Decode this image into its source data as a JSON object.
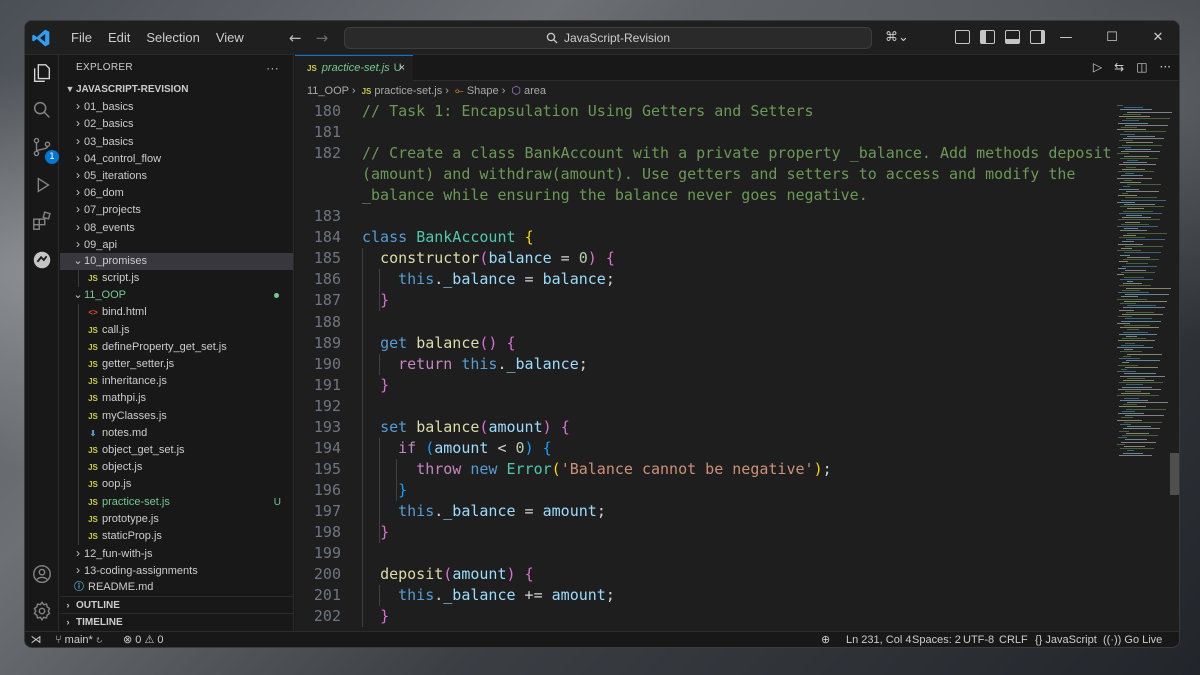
{
  "menu": [
    "File",
    "Edit",
    "Selection",
    "View"
  ],
  "search": {
    "label": "JavaScript-Revision"
  },
  "window_controls": {
    "minimize": "—",
    "maximize": "☐",
    "close": "✕"
  },
  "activity": {
    "source_control_badge": "1"
  },
  "explorer": {
    "title": "EXPLORER",
    "more": "···",
    "root": "JAVASCRIPT-REVISION",
    "items": [
      {
        "type": "folder",
        "name": "01_basics",
        "open": false,
        "level": 1
      },
      {
        "type": "folder",
        "name": "02_basics",
        "open": false,
        "level": 1
      },
      {
        "type": "folder",
        "name": "03_basics",
        "open": false,
        "level": 1
      },
      {
        "type": "folder",
        "name": "04_control_flow",
        "open": false,
        "level": 1
      },
      {
        "type": "folder",
        "name": "05_iterations",
        "open": false,
        "level": 1
      },
      {
        "type": "folder",
        "name": "06_dom",
        "open": false,
        "level": 1
      },
      {
        "type": "folder",
        "name": "07_projects",
        "open": false,
        "level": 1
      },
      {
        "type": "folder",
        "name": "08_events",
        "open": false,
        "level": 1
      },
      {
        "type": "folder",
        "name": "09_api",
        "open": false,
        "level": 1
      },
      {
        "type": "folder",
        "name": "10_promises",
        "open": true,
        "level": 1,
        "selected": true
      },
      {
        "type": "js",
        "name": "script.js",
        "level": 2
      },
      {
        "type": "folder",
        "name": "11_OOP",
        "open": true,
        "level": 1,
        "modified": true
      },
      {
        "type": "html",
        "name": "bind.html",
        "level": 2
      },
      {
        "type": "js",
        "name": "call.js",
        "level": 2
      },
      {
        "type": "js",
        "name": "defineProperty_get_set.js",
        "level": 2
      },
      {
        "type": "js",
        "name": "getter_setter.js",
        "level": 2
      },
      {
        "type": "js",
        "name": "inheritance.js",
        "level": 2
      },
      {
        "type": "js",
        "name": "mathpi.js",
        "level": 2
      },
      {
        "type": "js",
        "name": "myClasses.js",
        "level": 2
      },
      {
        "type": "md",
        "name": "notes.md",
        "level": 2
      },
      {
        "type": "js",
        "name": "object_get_set.js",
        "level": 2
      },
      {
        "type": "js",
        "name": "object.js",
        "level": 2
      },
      {
        "type": "js",
        "name": "oop.js",
        "level": 2
      },
      {
        "type": "js",
        "name": "practice-set.js",
        "level": 2,
        "status": "U"
      },
      {
        "type": "js",
        "name": "prototype.js",
        "level": 2
      },
      {
        "type": "js",
        "name": "staticProp.js",
        "level": 2
      },
      {
        "type": "folder",
        "name": "12_fun-with-js",
        "open": false,
        "level": 1
      },
      {
        "type": "folder",
        "name": "13-coding-assignments",
        "open": false,
        "level": 1
      },
      {
        "type": "info",
        "name": "README.md",
        "level": 1
      }
    ],
    "outline": "OUTLINE",
    "timeline": "TIMELINE"
  },
  "tab": {
    "icon": "JS",
    "name": "practice-set.js",
    "status": "U",
    "close": "×"
  },
  "breadcrumb": {
    "folder": "11_OOP",
    "icon": "JS",
    "file": "practice-set.js",
    "symbol1": "Shape",
    "symbol2": "area"
  },
  "code_lines": [
    {
      "n": "180",
      "tokens": [
        [
          "c-com",
          "// Task 1: Encapsulation Using Getters and Setters"
        ]
      ]
    },
    {
      "n": "181",
      "tokens": []
    },
    {
      "n": "182",
      "tokens": [
        [
          "c-com",
          "// Create a class BankAccount with a private property _balance. Add methods deposit"
        ]
      ]
    },
    {
      "n": "",
      "tokens": [
        [
          "c-com",
          "(amount) and withdraw(amount). Use getters and setters to access and modify the"
        ]
      ]
    },
    {
      "n": "",
      "tokens": [
        [
          "c-com",
          "_balance while ensuring the balance never goes negative."
        ]
      ]
    },
    {
      "n": "183",
      "tokens": []
    },
    {
      "n": "184",
      "tokens": [
        [
          "c-kw",
          "class "
        ],
        [
          "c-cls",
          "BankAccount "
        ],
        [
          "c-b1",
          "{"
        ]
      ]
    },
    {
      "n": "185",
      "tokens": [
        [
          "",
          "  "
        ],
        [
          "c-fn",
          "constructor"
        ],
        [
          "c-b2",
          "("
        ],
        [
          "c-var",
          "balance"
        ],
        [
          "",
          " = "
        ],
        [
          "c-num",
          "0"
        ],
        [
          "c-b2",
          ")"
        ],
        [
          "",
          " "
        ],
        [
          "c-b2",
          "{"
        ]
      ]
    },
    {
      "n": "186",
      "tokens": [
        [
          "",
          "    "
        ],
        [
          "c-kw",
          "this"
        ],
        [
          "",
          "."
        ],
        [
          "c-var",
          "_balance"
        ],
        [
          "",
          " = "
        ],
        [
          "c-var",
          "balance"
        ],
        [
          "",
          ";"
        ]
      ]
    },
    {
      "n": "187",
      "tokens": [
        [
          "",
          "  "
        ],
        [
          "c-b2",
          "}"
        ]
      ]
    },
    {
      "n": "188",
      "tokens": []
    },
    {
      "n": "189",
      "tokens": [
        [
          "",
          "  "
        ],
        [
          "c-kw",
          "get "
        ],
        [
          "c-fn",
          "balance"
        ],
        [
          "c-b2",
          "()"
        ],
        [
          "",
          " "
        ],
        [
          "c-b2",
          "{"
        ]
      ]
    },
    {
      "n": "190",
      "tokens": [
        [
          "",
          "    "
        ],
        [
          "c-kw2",
          "return "
        ],
        [
          "c-kw",
          "this"
        ],
        [
          "",
          "."
        ],
        [
          "c-var",
          "_balance"
        ],
        [
          "",
          ";"
        ]
      ]
    },
    {
      "n": "191",
      "tokens": [
        [
          "",
          "  "
        ],
        [
          "c-b2",
          "}"
        ]
      ]
    },
    {
      "n": "192",
      "tokens": []
    },
    {
      "n": "193",
      "tokens": [
        [
          "",
          "  "
        ],
        [
          "c-kw",
          "set "
        ],
        [
          "c-fn",
          "balance"
        ],
        [
          "c-b2",
          "("
        ],
        [
          "c-var",
          "amount"
        ],
        [
          "c-b2",
          ")"
        ],
        [
          "",
          " "
        ],
        [
          "c-b2",
          "{"
        ]
      ]
    },
    {
      "n": "194",
      "tokens": [
        [
          "",
          "    "
        ],
        [
          "c-kw2",
          "if "
        ],
        [
          "c-b3",
          "("
        ],
        [
          "c-var",
          "amount"
        ],
        [
          "",
          " < "
        ],
        [
          "c-num",
          "0"
        ],
        [
          "c-b3",
          ")"
        ],
        [
          "",
          " "
        ],
        [
          "c-b3",
          "{"
        ]
      ]
    },
    {
      "n": "195",
      "tokens": [
        [
          "",
          "      "
        ],
        [
          "c-kw2",
          "throw "
        ],
        [
          "c-kw",
          "new "
        ],
        [
          "c-cls",
          "Error"
        ],
        [
          "c-b1",
          "("
        ],
        [
          "c-str",
          "'Balance cannot be negative'"
        ],
        [
          "c-b1",
          ")"
        ],
        [
          "",
          ";"
        ]
      ]
    },
    {
      "n": "196",
      "tokens": [
        [
          "",
          "    "
        ],
        [
          "c-b3",
          "}"
        ]
      ]
    },
    {
      "n": "197",
      "tokens": [
        [
          "",
          "    "
        ],
        [
          "c-kw",
          "this"
        ],
        [
          "",
          "."
        ],
        [
          "c-var",
          "_balance"
        ],
        [
          "",
          " = "
        ],
        [
          "c-var",
          "amount"
        ],
        [
          "",
          ";"
        ]
      ]
    },
    {
      "n": "198",
      "tokens": [
        [
          "",
          "  "
        ],
        [
          "c-b2",
          "}"
        ]
      ]
    },
    {
      "n": "199",
      "tokens": []
    },
    {
      "n": "200",
      "tokens": [
        [
          "",
          "  "
        ],
        [
          "c-fn",
          "deposit"
        ],
        [
          "c-b2",
          "("
        ],
        [
          "c-var",
          "amount"
        ],
        [
          "c-b2",
          ")"
        ],
        [
          "",
          " "
        ],
        [
          "c-b2",
          "{"
        ]
      ]
    },
    {
      "n": "201",
      "tokens": [
        [
          "",
          "    "
        ],
        [
          "c-kw",
          "this"
        ],
        [
          "",
          "."
        ],
        [
          "c-var",
          "_balance"
        ],
        [
          "",
          " += "
        ],
        [
          "c-var",
          "amount"
        ],
        [
          "",
          ";"
        ]
      ]
    },
    {
      "n": "202",
      "tokens": [
        [
          "",
          "  "
        ],
        [
          "c-b2",
          "}"
        ]
      ]
    }
  ],
  "statusbar": {
    "branch": "main*",
    "errors": "0",
    "warnings": "0",
    "position": "Ln 231, Col 4",
    "spaces": "Spaces: 2",
    "encoding": "UTF-8",
    "eol": "CRLF",
    "language": "JavaScript",
    "golive": "Go Live"
  }
}
